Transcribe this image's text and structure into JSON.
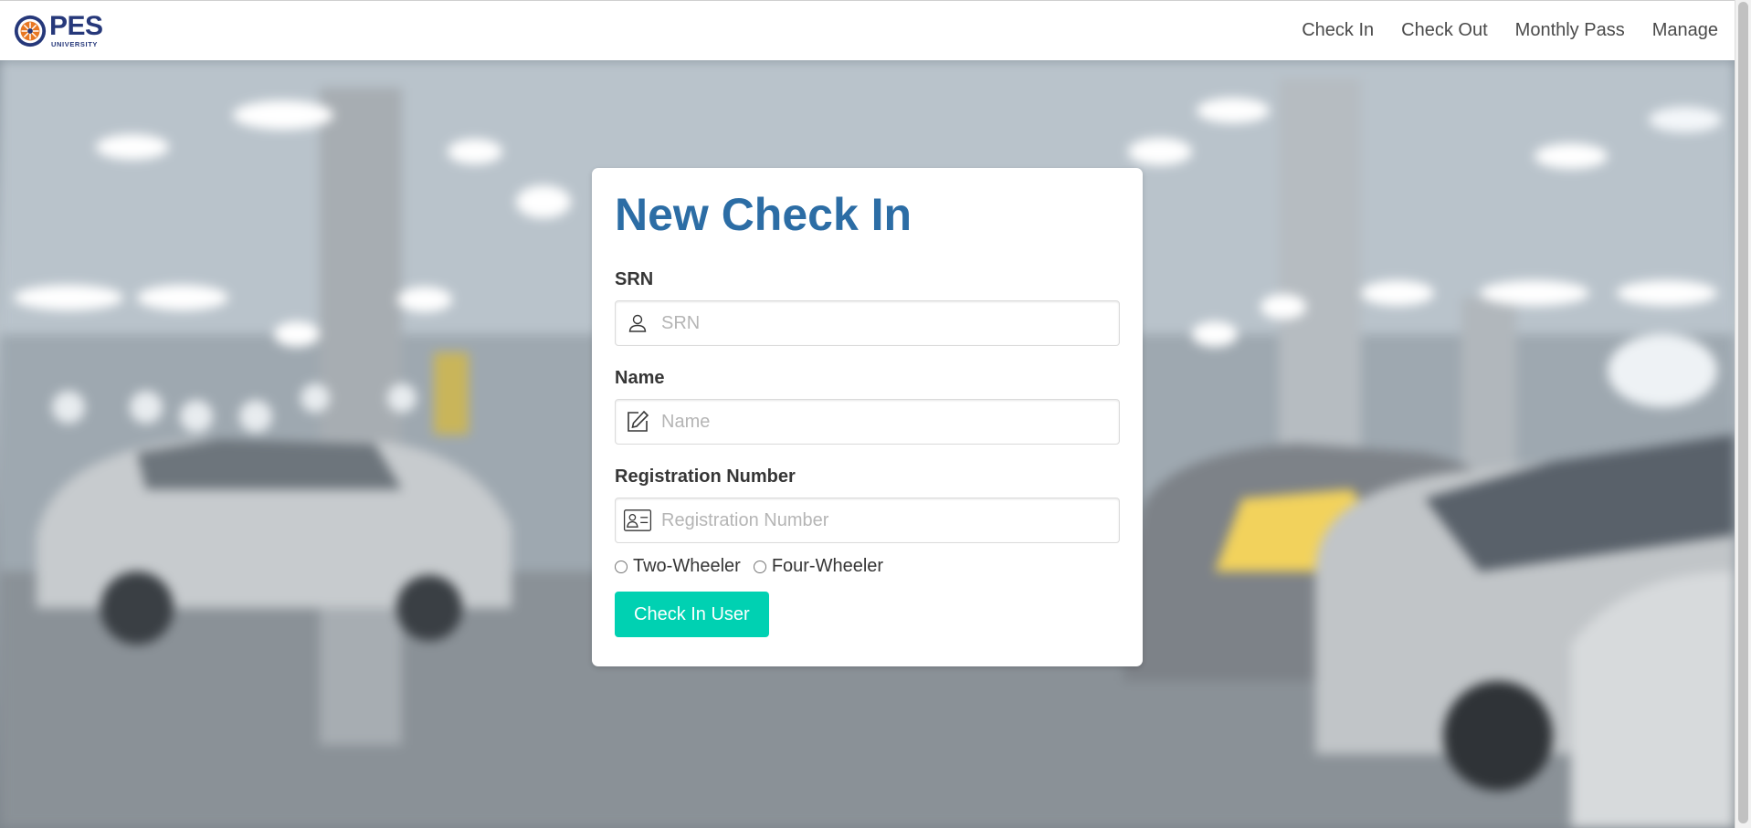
{
  "brand": {
    "name": "PES",
    "sub": "UNIVERSITY"
  },
  "nav": [
    {
      "label": "Check In"
    },
    {
      "label": "Check Out"
    },
    {
      "label": "Monthly Pass"
    },
    {
      "label": "Manage"
    }
  ],
  "form": {
    "title": "New Check In",
    "fields": [
      {
        "label": "SRN",
        "placeholder": "SRN",
        "icon": "user-icon"
      },
      {
        "label": "Name",
        "placeholder": "Name",
        "icon": "edit-icon"
      },
      {
        "label": "Registration Number",
        "placeholder": "Registration Number",
        "icon": "id-card-icon"
      }
    ],
    "vehicle_options": [
      {
        "label": "Two-Wheeler",
        "selected": false
      },
      {
        "label": "Four-Wheeler",
        "selected": false
      }
    ],
    "submit_label": "Check In User"
  },
  "colors": {
    "title": "#2c6da5",
    "button": "#00d1b2",
    "brand": "#26387a",
    "seal_accent": "#e87722"
  }
}
